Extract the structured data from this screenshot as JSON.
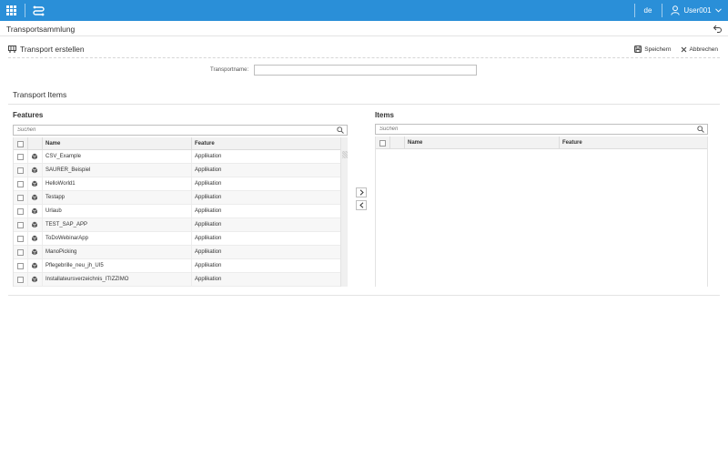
{
  "topbar": {
    "lang": "de",
    "user": "User001",
    "menu_icon": "grid-icon",
    "app_icon": "transport-route-icon",
    "user_icon": "user-icon",
    "accent": "#2a8fd8"
  },
  "shell": {
    "title": "Transportsammlung",
    "back_icon": "back-arrow-icon"
  },
  "page": {
    "title": "Transport erstellen",
    "title_icon": "transport-icon",
    "save_label": "Speichern",
    "cancel_label": "Abbrechen"
  },
  "form": {
    "name_label": "Transportname:",
    "name_value": "",
    "name_placeholder": ""
  },
  "section": {
    "title": "Transport Items"
  },
  "features": {
    "title": "Features",
    "search_placeholder": "Suchen",
    "columns": {
      "name": "Name",
      "feature": "Feature"
    },
    "rows": [
      {
        "name": "CSV_Example",
        "feature": "Applikation"
      },
      {
        "name": "SAURER_Beispiel",
        "feature": "Applikation"
      },
      {
        "name": "HelloWorld1",
        "feature": "Applikation"
      },
      {
        "name": "Testapp",
        "feature": "Applikation"
      },
      {
        "name": "Urlaub",
        "feature": "Applikation"
      },
      {
        "name": "TEST_SAP_APP",
        "feature": "Applikation"
      },
      {
        "name": "ToDoWebinarApp",
        "feature": "Applikation"
      },
      {
        "name": "ManoPicking",
        "feature": "Applikation"
      },
      {
        "name": "Pflegebrille_neu_jh_UI5",
        "feature": "Applikation"
      },
      {
        "name": "Installateursverzeichnis_ITIZZIMO",
        "feature": "Applikation"
      }
    ]
  },
  "items": {
    "title": "Items",
    "search_placeholder": "Suchen",
    "columns": {
      "name": "Name",
      "feature": "Feature"
    },
    "rows": []
  },
  "move": {
    "right_icon": "chevron-right-icon",
    "left_icon": "chevron-left-icon"
  }
}
